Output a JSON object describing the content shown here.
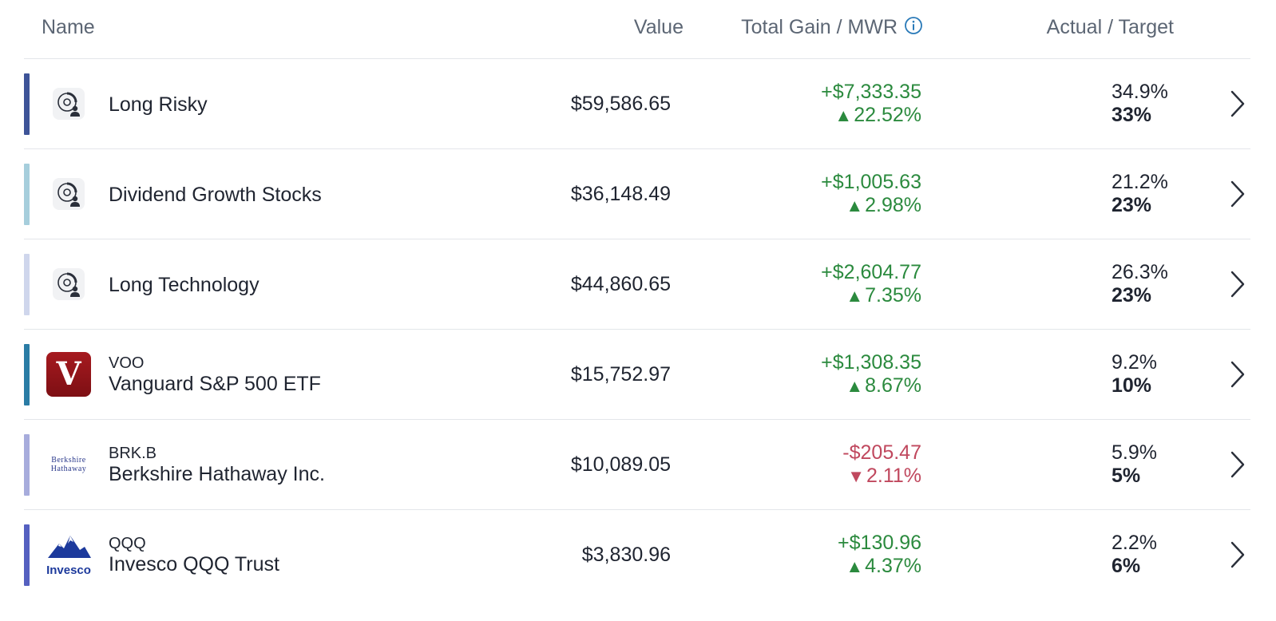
{
  "header": {
    "name": "Name",
    "value": "Value",
    "gain": "Total Gain / MWR",
    "target": "Actual / Target",
    "info_icon": "info-icon"
  },
  "rows": [
    {
      "logo": "portfolio-person-icon",
      "ticker": "",
      "name": "Long Risky",
      "value": "$59,586.65",
      "gain": "+$7,333.35",
      "gain_pct": "22.52%",
      "direction": "up",
      "actual": "34.9%",
      "target": "33%",
      "bar_color": "#3e5498"
    },
    {
      "logo": "portfolio-person-icon",
      "ticker": "",
      "name": "Dividend Growth Stocks",
      "value": "$36,148.49",
      "gain": "+$1,005.63",
      "gain_pct": "2.98%",
      "direction": "up",
      "actual": "21.2%",
      "target": "23%",
      "bar_color": "#a6cedc"
    },
    {
      "logo": "portfolio-person-icon",
      "ticker": "",
      "name": "Long Technology",
      "value": "$44,860.65",
      "gain": "+$2,604.77",
      "gain_pct": "7.35%",
      "direction": "up",
      "actual": "26.3%",
      "target": "23%",
      "bar_color": "#cfd6ec"
    },
    {
      "logo": "vanguard-logo",
      "logo_text": "V",
      "ticker": "VOO",
      "name": "Vanguard S&P 500 ETF",
      "value": "$15,752.97",
      "gain": "+$1,308.35",
      "gain_pct": "8.67%",
      "direction": "up",
      "actual": "9.2%",
      "target": "10%",
      "bar_color": "#2a7ca5"
    },
    {
      "logo": "berkshire-logo",
      "logo_text_1": "Berkshire",
      "logo_text_2": "Hathaway",
      "ticker": "BRK.B",
      "name": "Berkshire Hathaway Inc.",
      "value": "$10,089.05",
      "gain": "-$205.47",
      "gain_pct": "2.11%",
      "direction": "down",
      "actual": "5.9%",
      "target": "5%",
      "bar_color": "#a7acdc"
    },
    {
      "logo": "invesco-logo",
      "logo_text": "Invesco",
      "ticker": "QQQ",
      "name": "Invesco QQQ Trust",
      "value": "$3,830.96",
      "gain": "+$130.96",
      "gain_pct": "4.37%",
      "direction": "up",
      "actual": "2.2%",
      "target": "6%",
      "bar_color": "#5560c0"
    }
  ],
  "colors": {
    "positive": "#2b8a3e",
    "negative": "#c0485e",
    "header_text": "#5c6674",
    "info_accent": "#2a7ab8"
  },
  "glyphs": {
    "up": "▲",
    "down": "▼"
  }
}
